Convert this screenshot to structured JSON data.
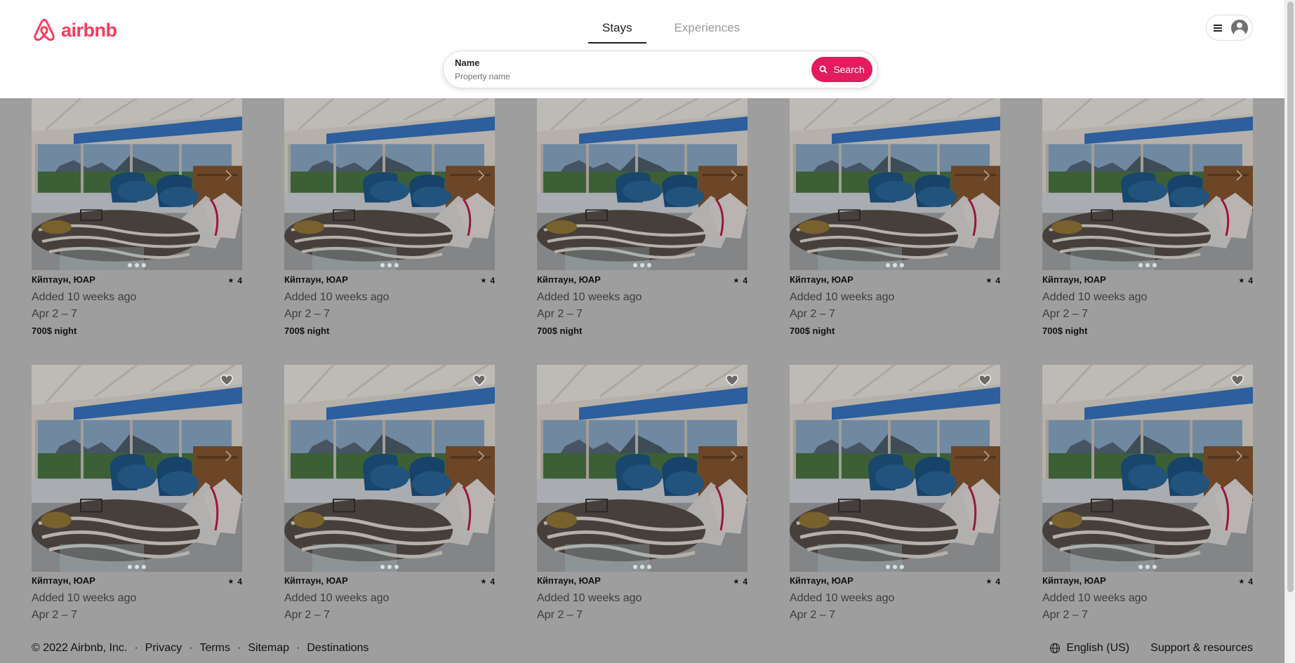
{
  "brand": {
    "name": "airbnb",
    "color": "#FF385C"
  },
  "tabs": [
    {
      "label": "Stays",
      "active": true
    },
    {
      "label": "Experiences",
      "active": false
    }
  ],
  "user_menu": {
    "menu_icon": "hamburger-icon",
    "avatar_icon": "user-avatar-icon"
  },
  "search": {
    "label": "Name",
    "placeholder": "Property name",
    "value": "",
    "button_label": "Search",
    "button_color": "#E31C5F"
  },
  "listings": [
    {
      "location": "Кйптаун, ЮАР",
      "rating": "4",
      "added": "Added 10 weeks ago",
      "dates": "Apr 2 – 7",
      "price": "700$ night"
    },
    {
      "location": "Кйптаун, ЮАР",
      "rating": "4",
      "added": "Added 10 weeks ago",
      "dates": "Apr 2 – 7",
      "price": "700$ night"
    },
    {
      "location": "Кйптаун, ЮАР",
      "rating": "4",
      "added": "Added 10 weeks ago",
      "dates": "Apr 2 – 7",
      "price": "700$ night"
    },
    {
      "location": "Кйптаун, ЮАР",
      "rating": "4",
      "added": "Added 10 weeks ago",
      "dates": "Apr 2 – 7",
      "price": "700$ night"
    },
    {
      "location": "Кйптаун, ЮАР",
      "rating": "4",
      "added": "Added 10 weeks ago",
      "dates": "Apr 2 – 7",
      "price": "700$ night"
    },
    {
      "location": "Кйптаун, ЮАР",
      "rating": "4",
      "added": "Added 10 weeks ago",
      "dates": "Apr 2 – 7",
      "price": ""
    },
    {
      "location": "Кйптаун, ЮАР",
      "rating": "4",
      "added": "Added 10 weeks ago",
      "dates": "Apr 2 – 7",
      "price": ""
    },
    {
      "location": "Кйптаун, ЮАР",
      "rating": "4",
      "added": "Added 10 weeks ago",
      "dates": "Apr 2 – 7",
      "price": ""
    },
    {
      "location": "Кйптаун, ЮАР",
      "rating": "4",
      "added": "Added 10 weeks ago",
      "dates": "Apr 2 – 7",
      "price": ""
    },
    {
      "location": "Кйптаун, ЮАР",
      "rating": "4",
      "added": "Added 10 weeks ago",
      "dates": "Apr 2 – 7",
      "price": ""
    }
  ],
  "footer": {
    "copyright": "© 2022 Airbnb, Inc.",
    "links": [
      "Privacy",
      "Terms",
      "Sitemap",
      "Destinations"
    ],
    "separator": "·",
    "language": "English (US)",
    "support": "Support & resources"
  },
  "overlay_color": "#9e9e9e"
}
